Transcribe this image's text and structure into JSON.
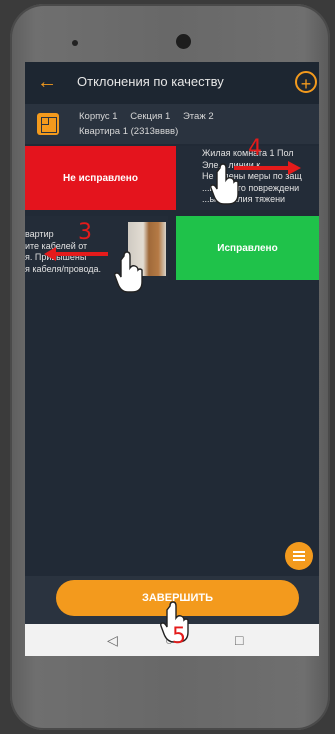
{
  "header": {
    "title": "Отклонения по качеству"
  },
  "info": {
    "building": "Корпус 1",
    "section": "Секция 1",
    "floor": "Этаж 2",
    "apartment": "Квартира 1 (2313вввв)"
  },
  "swipe": {
    "not_fixed_label": "Не исправлено",
    "fixed_label": "Исправлено"
  },
  "cards": {
    "card1_lines": [
      "Жилая комната 1 Пол",
      "Эле...     линии к...",
      "Не ...дены меры по защ",
      "...ического повреждени",
      "...ые усилия тяжени"
    ],
    "card2_lines": [
      "вартир",
      "ите кабелей от",
      "я. Привышены",
      "я кабеля/провода."
    ]
  },
  "footer": {
    "finish_label": "ЗАВЕРШИТЬ"
  },
  "annotations": {
    "step3": "3",
    "step4": "4",
    "step5": "5"
  },
  "colors": {
    "accent": "#f39a1d",
    "danger": "#e4141d",
    "success": "#1fc24a"
  }
}
